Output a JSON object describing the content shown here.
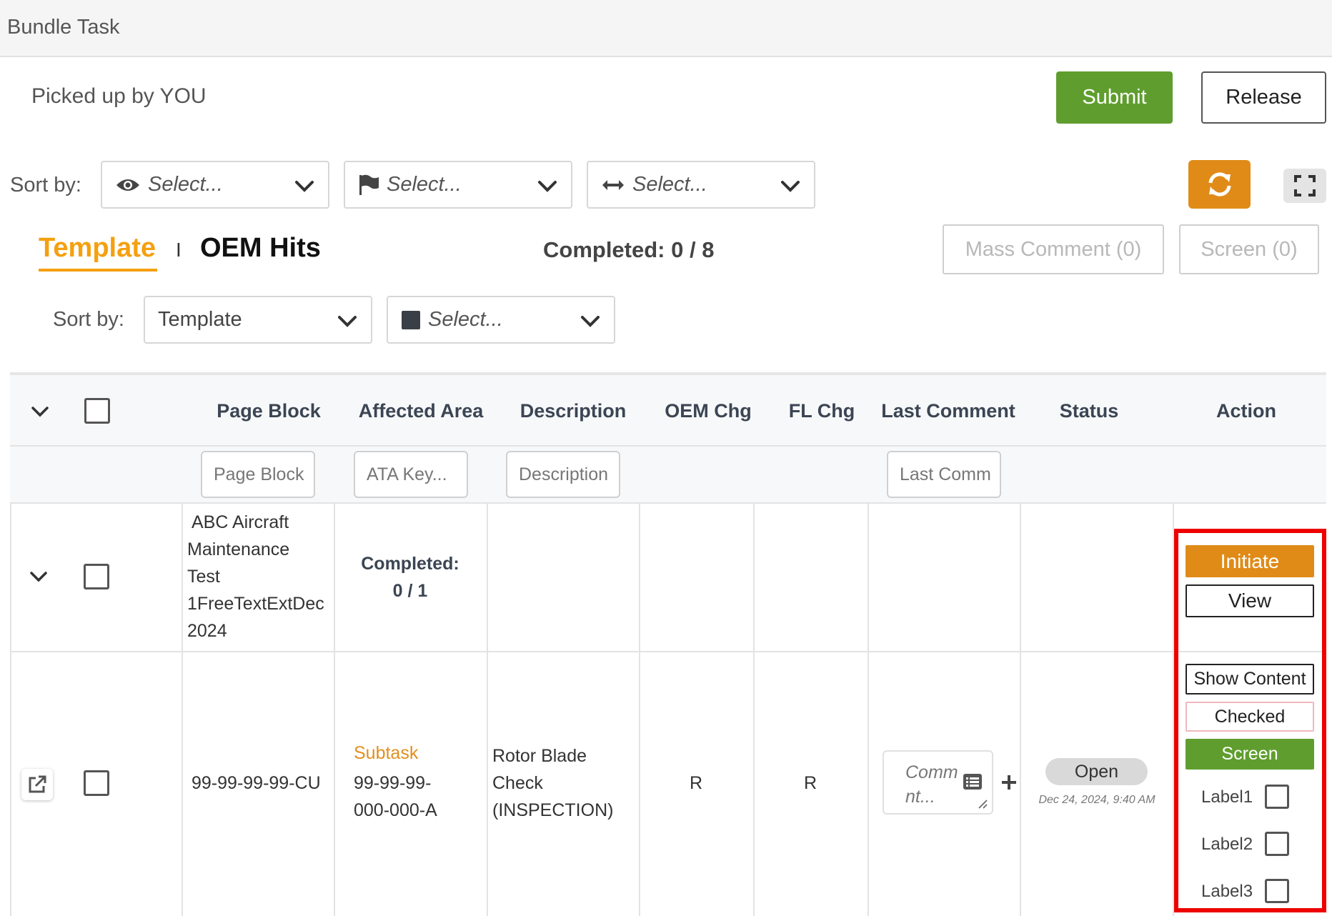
{
  "header": {
    "title": "Bundle Task"
  },
  "status_line": {
    "picked_up": "Picked up by YOU"
  },
  "actions": {
    "submit": "Submit",
    "release": "Release"
  },
  "sort_bar": {
    "label": "Sort by:",
    "selects": [
      {
        "icon": "eye-icon",
        "placeholder": "Select..."
      },
      {
        "icon": "flag-icon",
        "placeholder": "Select..."
      },
      {
        "icon": "arrows-horizontal-icon",
        "placeholder": "Select..."
      }
    ]
  },
  "tabs": {
    "template": "Template",
    "separator": "I",
    "oem_hits": "OEM Hits"
  },
  "progress": {
    "completed_text": "Completed: 0 / 8"
  },
  "bulk_actions": {
    "mass_comment": "Mass Comment (0)",
    "screen": "Screen (0)"
  },
  "sort_bar_2": {
    "label": "Sort by:",
    "template_value": "Template",
    "second_placeholder": "Select..."
  },
  "table": {
    "columns": [
      "Page Block",
      "Affected Area",
      "Description",
      "OEM Chg",
      "FL Chg",
      "Last Comment",
      "Status",
      "Action"
    ],
    "filters": {
      "page_block": "Page Block",
      "affected_area": "ATA Key...",
      "description": "Description",
      "last_comment": "Last Comm"
    },
    "rows": [
      {
        "page_block_lines": [
          "ABC Aircraft",
          "Maintenance",
          "Test",
          "1FreeTextExtDec",
          "2024"
        ],
        "completed_label": "Completed:",
        "completed_value": "0 / 1",
        "actions": {
          "initiate": "Initiate",
          "view": "View"
        }
      },
      {
        "page_block": "99-99-99-99-CU",
        "affected_area_type": "Subtask",
        "affected_area_lines": [
          "99-99-99-",
          "000-000-A"
        ],
        "description_lines": [
          "Rotor Blade",
          "Check",
          "(INSPECTION)"
        ],
        "oem_chg": "R",
        "fl_chg": "R",
        "comment_placeholder_lines": [
          "Comm",
          "nt..."
        ],
        "status": "Open",
        "status_date": "Dec 24, 2024, 9:40 AM",
        "actions": {
          "show_content": "Show Content",
          "checked": "Checked",
          "screen": "Screen",
          "labels": [
            "Label1",
            "Label2",
            "Label3"
          ]
        }
      }
    ]
  },
  "colors": {
    "accent_orange": "#e08b17",
    "tab_orange": "#f5a010",
    "green": "#5f9e2e",
    "highlight_red": "#ee0000"
  }
}
